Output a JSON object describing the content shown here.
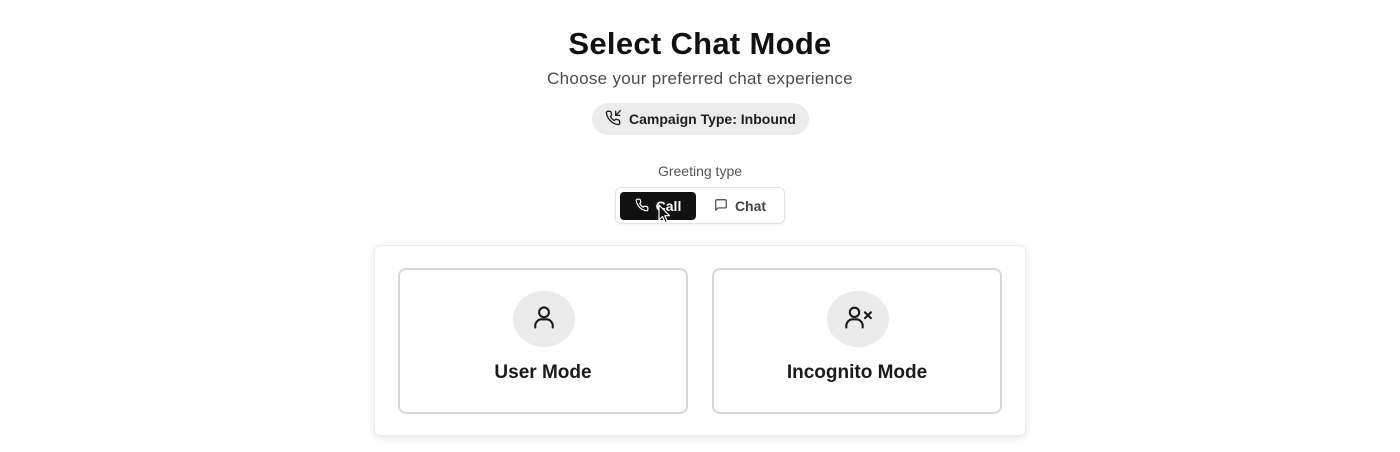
{
  "header": {
    "title": "Select Chat Mode",
    "subtitle": "Choose your preferred chat experience"
  },
  "campaign": {
    "label": "Campaign Type: Inbound",
    "icon": "phone-incoming-icon"
  },
  "greeting": {
    "label": "Greeting type",
    "options": [
      {
        "label": "Call",
        "icon": "phone-icon",
        "selected": true
      },
      {
        "label": "Chat",
        "icon": "message-square-icon",
        "selected": false
      }
    ]
  },
  "modes": [
    {
      "label": "User Mode",
      "icon": "user-icon"
    },
    {
      "label": "Incognito Mode",
      "icon": "user-x-icon"
    }
  ],
  "colors": {
    "active_toggle": "#111111",
    "badge_bg": "#ececec",
    "icon_circle": "#ebebeb"
  }
}
